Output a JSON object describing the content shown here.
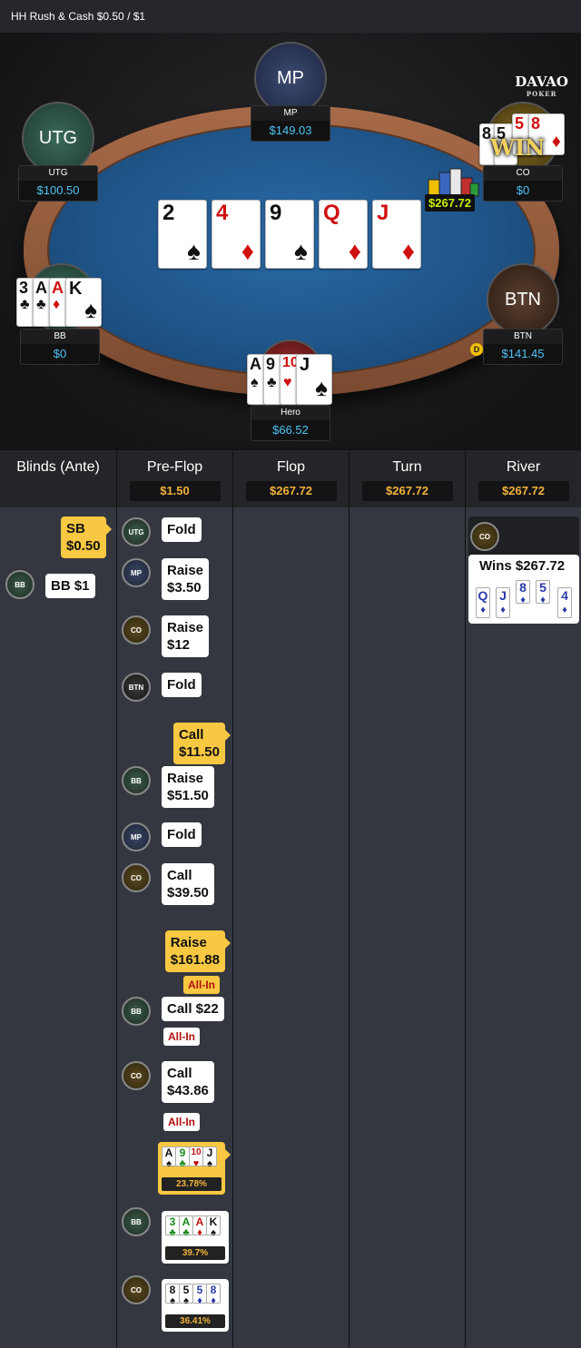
{
  "header": {
    "title": "HH  Rush & Cash $0.50 / $1"
  },
  "logo": {
    "name": "DAVAO",
    "sub": "POKER"
  },
  "seats": {
    "mp": {
      "circle": "MP",
      "name": "MP",
      "stack": "$149.03"
    },
    "utg": {
      "circle": "UTG",
      "name": "UTG",
      "stack": "$100.50"
    },
    "co": {
      "name": "CO",
      "stack": "$0"
    },
    "bb": {
      "name": "BB",
      "stack": "$0"
    },
    "btn": {
      "circle": "BTN",
      "name": "BTN",
      "stack": "$141.45"
    },
    "hero": {
      "name": "Hero",
      "stack": "$66.52"
    }
  },
  "board": [
    {
      "rank": "2",
      "suit": "♠",
      "color": "black"
    },
    {
      "rank": "4",
      "suit": "♦",
      "color": "red"
    },
    {
      "rank": "9",
      "suit": "♠",
      "color": "black"
    },
    {
      "rank": "Q",
      "suit": "♦",
      "color": "red"
    },
    {
      "rank": "J",
      "suit": "♦",
      "color": "red"
    }
  ],
  "pot": "$267.72",
  "win_text": "WIN",
  "dealer_label": "D",
  "columns": {
    "blinds": {
      "title": "Blinds (Ante)"
    },
    "preflop": {
      "title": "Pre-Flop",
      "pot": "$1.50"
    },
    "flop": {
      "title": "Flop",
      "pot": "$267.72"
    },
    "turn": {
      "title": "Turn",
      "pot": "$267.72"
    },
    "river": {
      "title": "River",
      "pot": "$267.72"
    }
  },
  "blinds_actions": {
    "sb": {
      "line1": "SB",
      "line2": "$0.50"
    },
    "bb": {
      "avatar": "BB",
      "text": "BB  $1"
    }
  },
  "preflop_actions": [
    {
      "avatar": "UTG",
      "l1": "Fold",
      "l2": ""
    },
    {
      "avatar": "MP",
      "l1": "Raise",
      "l2": "$3.50"
    },
    {
      "avatar": "CO",
      "l1": "Raise",
      "l2": "$12"
    },
    {
      "avatar": "BTN",
      "l1": "Fold",
      "l2": ""
    },
    {
      "avatar": "",
      "l1": "Call",
      "l2": "$11.50"
    },
    {
      "avatar": "BB",
      "l1": "Raise",
      "l2": "$51.50"
    },
    {
      "avatar": "MP",
      "l1": "Fold",
      "l2": ""
    },
    {
      "avatar": "CO",
      "l1": "Call",
      "l2": "$39.50"
    },
    {
      "avatar": "",
      "l1": "Raise",
      "l2": "$161.88",
      "allin": "All-In"
    },
    {
      "avatar": "BB",
      "l1": "Call  $22",
      "l2": "",
      "allin": "All-In"
    },
    {
      "avatar": "CO",
      "l1": "Call",
      "l2": "$43.86",
      "allin": "All-In"
    }
  ],
  "equity": [
    {
      "avatar": "",
      "pct": "23.78%"
    },
    {
      "avatar": "BB",
      "pct": "39.7%"
    },
    {
      "avatar": "CO",
      "pct": "36.41%"
    }
  ],
  "river_result": {
    "avatar": "CO",
    "text": "Wins $267.72"
  }
}
